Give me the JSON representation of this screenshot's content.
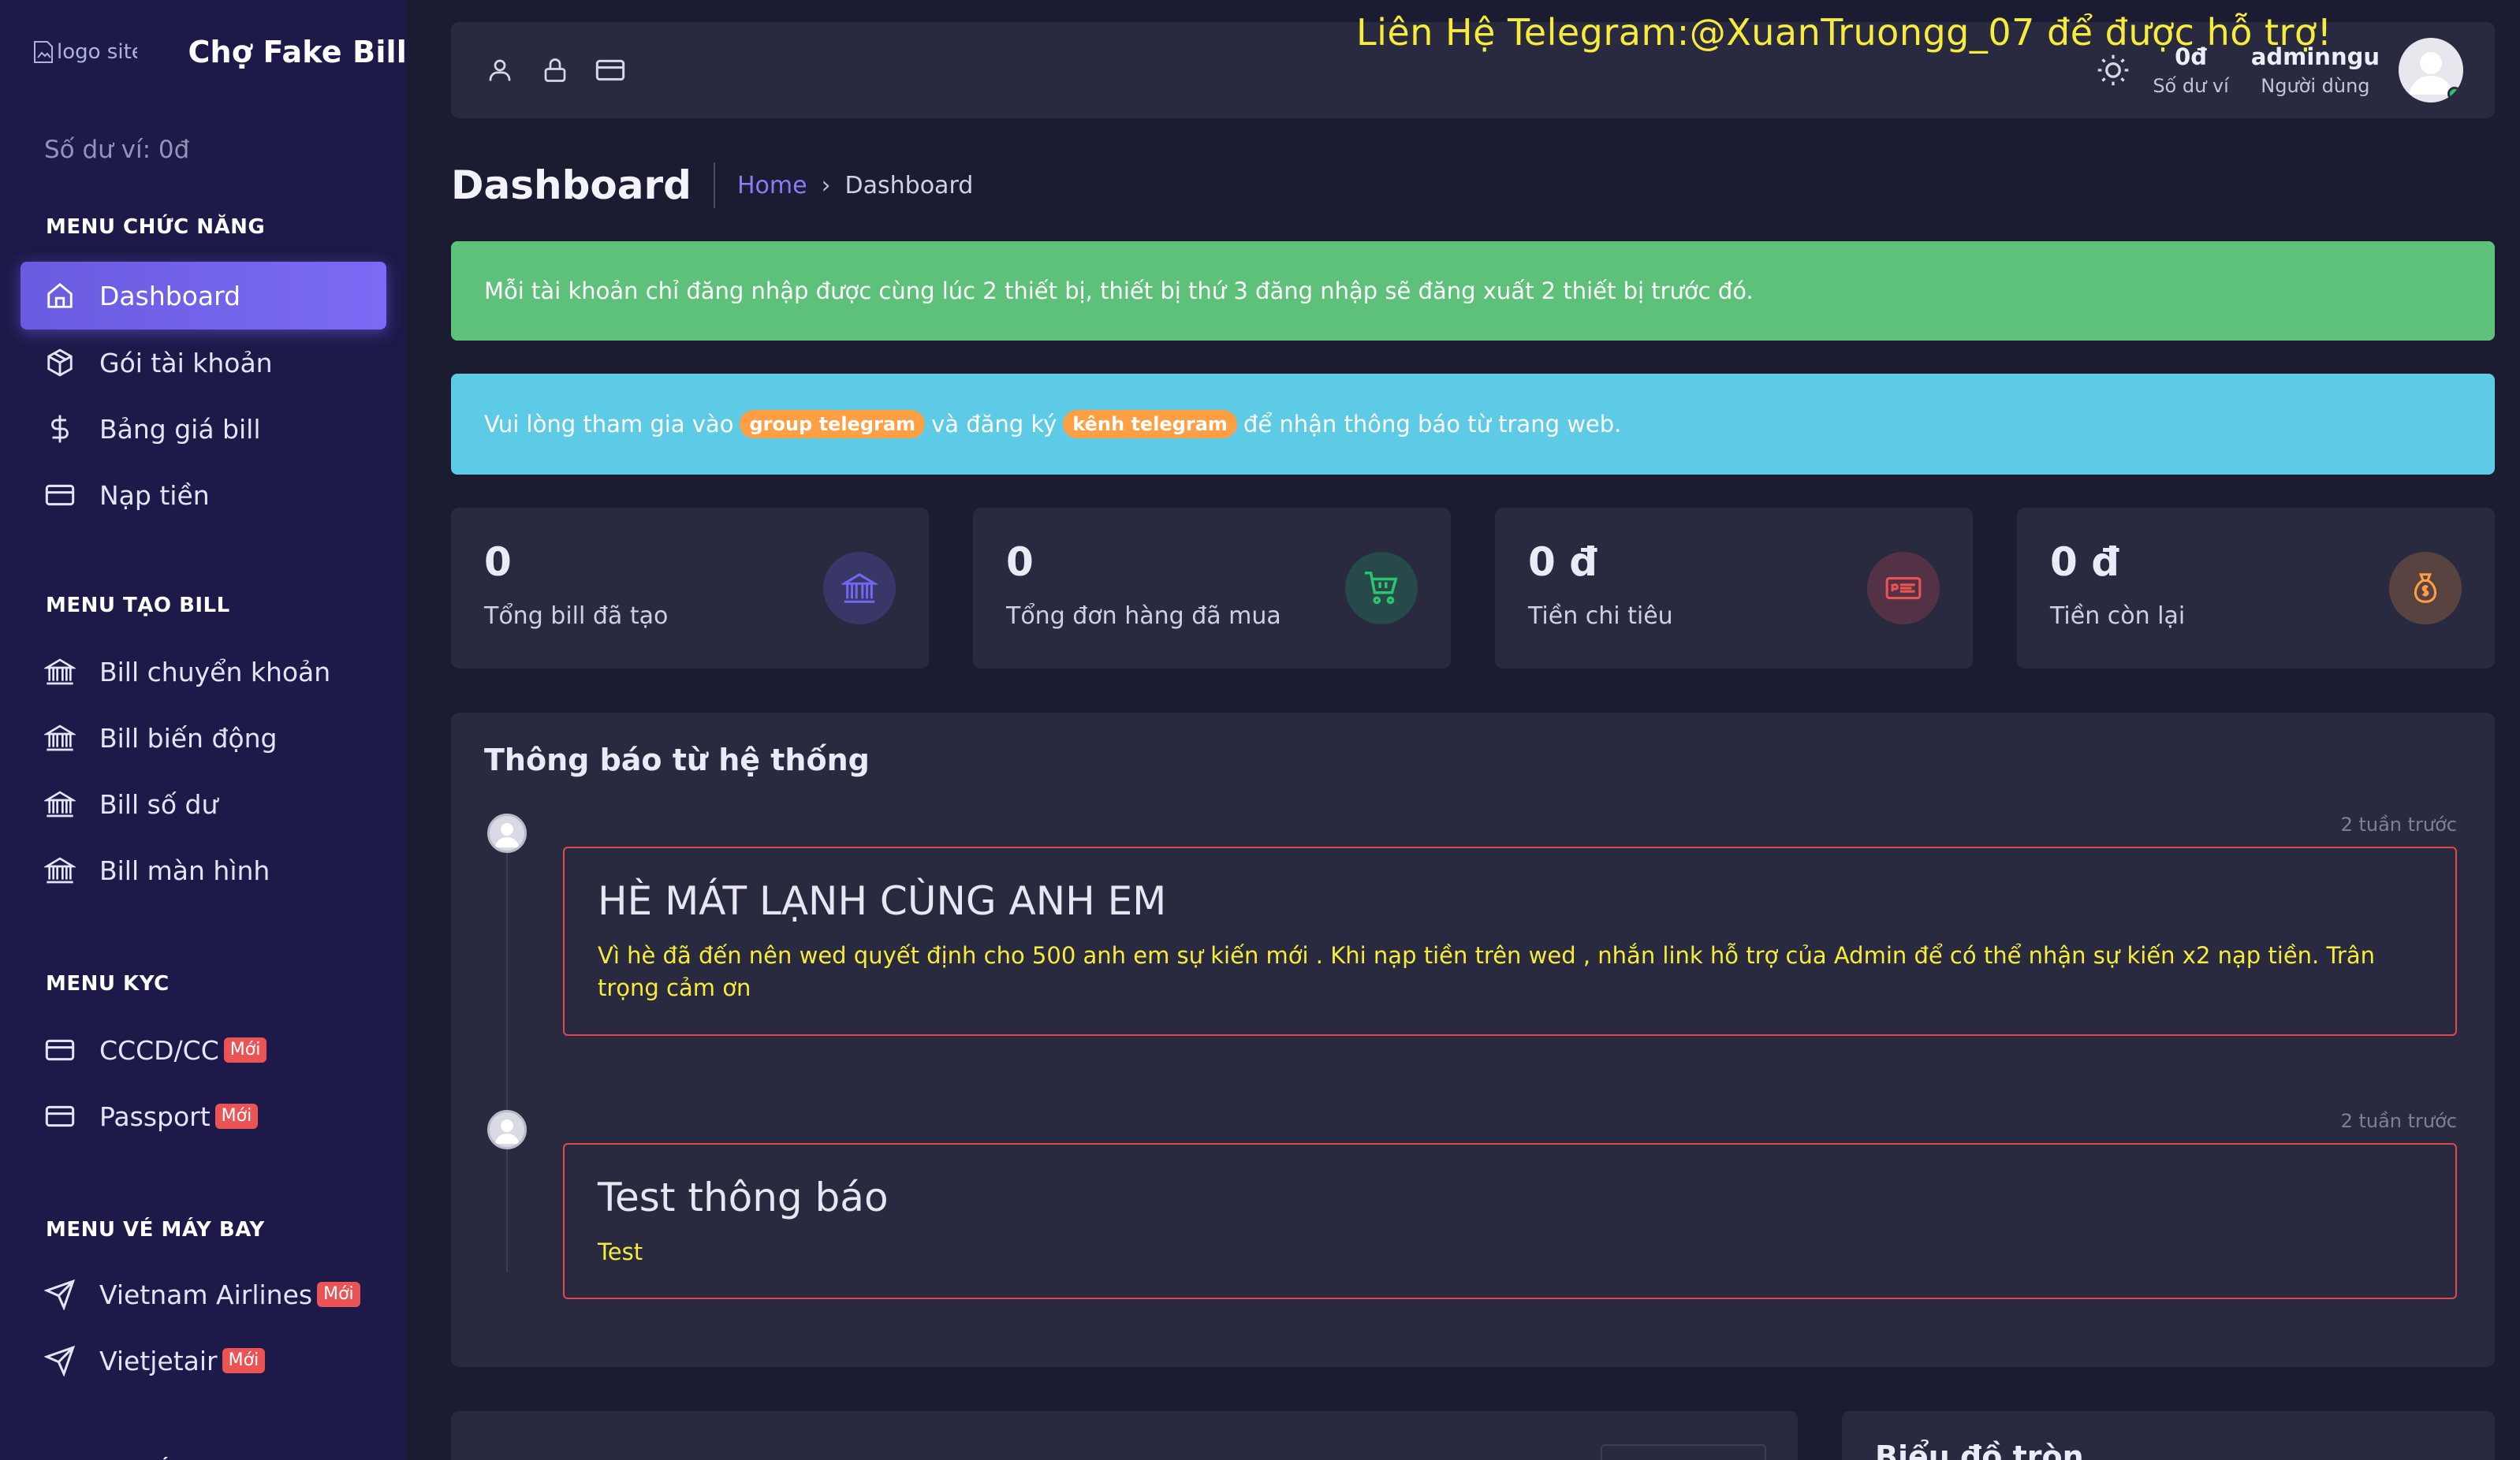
{
  "brand": {
    "logo_alt": "logo site",
    "name": "Chợ Fake Bill"
  },
  "sidebar": {
    "balance_label": "Số dư ví: 0đ",
    "sections": [
      {
        "title": "MENU CHỨC NĂNG",
        "items": [
          {
            "label": "Dashboard",
            "icon": "home-icon",
            "active": true
          },
          {
            "label": "Gói tài khoản",
            "icon": "package-icon"
          },
          {
            "label": "Bảng giá bill",
            "icon": "dollar-icon"
          },
          {
            "label": "Nạp tiền",
            "icon": "credit-card-icon"
          }
        ]
      },
      {
        "title": "MENU TẠO BILL",
        "items": [
          {
            "label": "Bill chuyển khoản",
            "icon": "bank-icon"
          },
          {
            "label": "Bill biến động",
            "icon": "bank-icon"
          },
          {
            "label": "Bill số dư",
            "icon": "bank-icon"
          },
          {
            "label": "Bill màn hình",
            "icon": "bank-icon"
          }
        ]
      },
      {
        "title": "MENU KYC",
        "items": [
          {
            "label": "CCCD/CC",
            "icon": "credit-card-icon",
            "badge": "Mới"
          },
          {
            "label": "Passport",
            "icon": "credit-card-icon",
            "badge": "Mới"
          }
        ]
      },
      {
        "title": "MENU VÉ MÁY BAY",
        "items": [
          {
            "label": "Vietnam Airlines",
            "icon": "send-icon",
            "badge": "Mới"
          },
          {
            "label": "Vietjetair",
            "icon": "send-icon",
            "badge": "Mới"
          }
        ]
      },
      {
        "title": "MENU KHÁC",
        "items": []
      }
    ]
  },
  "topnav": {
    "marquee": "Liên Hệ Telegram:@XuanTruongg_07 để được hỗ trợ!",
    "balance_value": "0đ",
    "balance_label": "Số dư ví",
    "username": "adminngu",
    "role": "Người dùng"
  },
  "page": {
    "title": "Dashboard",
    "breadcrumb_home": "Home",
    "breadcrumb_current": "Dashboard"
  },
  "alerts": {
    "green": "Mỗi tài khoản chỉ đăng nhập được cùng lúc 2 thiết bị, thiết bị thứ 3 đăng nhập sẽ đăng xuất 2 thiết bị trước đó.",
    "blue_prefix": "Vui lòng tham gia vào",
    "blue_pill1": "group telegram",
    "blue_mid": "và đăng ký",
    "blue_pill2": "kênh telegram",
    "blue_suffix": "để nhận thông báo từ trang web."
  },
  "stats": [
    {
      "value": "0",
      "label": "Tổng bill đã tạo",
      "icon": "bank-icon",
      "color": "#7367f0"
    },
    {
      "value": "0",
      "label": "Tổng đơn hàng đã mua",
      "icon": "cart-icon",
      "color": "#28c76f"
    },
    {
      "value": "0 đ",
      "label": "Tiền chi tiêu",
      "icon": "money-bill-icon",
      "color": "#ea5455"
    },
    {
      "value": "0 đ",
      "label": "Tiền còn lại",
      "icon": "money-bag-icon",
      "color": "#ff9f43"
    }
  ],
  "notifications": {
    "title": "Thông báo từ hệ thống",
    "items": [
      {
        "time": "2 tuần trước",
        "heading": "HÈ MÁT LẠNH CÙNG ANH EM",
        "body": "Vì hè đã đến nên wed quyết định cho 500 anh em sự kiến mới . Khi nạp tiền trên wed , nhắn link hỗ trợ của Admin để có thể nhận sự kiến x2 nạp tiền. Trân trọng cảm ơn"
      },
      {
        "time": "2 tuần trước",
        "heading": "Test thông báo",
        "body": "Test"
      }
    ]
  },
  "bottom": {
    "right_title": "Biểu đồ tròn"
  },
  "colors": {
    "sidebar_bg": "#1d1a4a",
    "card_bg": "#292a40",
    "accent": "#7367f0",
    "success": "#5dc179",
    "info": "#5ecbe6",
    "warning": "#ff9f43",
    "danger": "#ea5455",
    "marquee": "#f7ec3a"
  }
}
